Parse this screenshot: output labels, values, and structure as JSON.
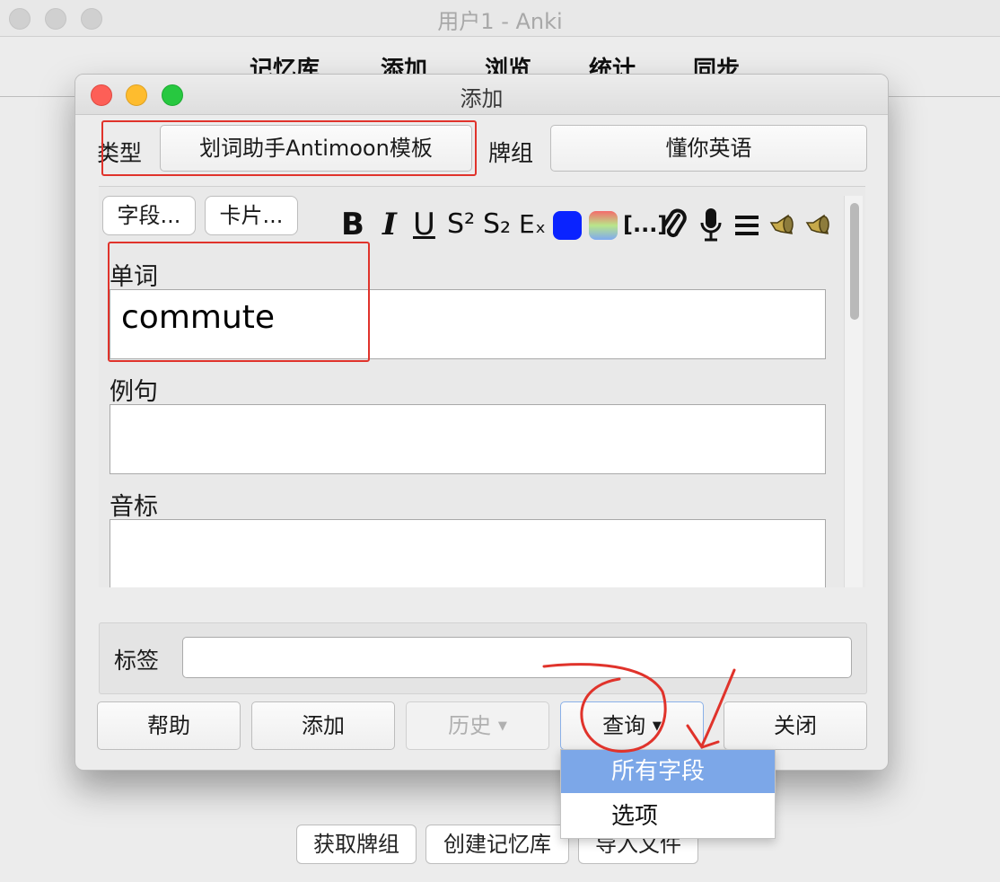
{
  "main_window": {
    "title": "用户1 - Anki",
    "toolbar": [
      "记忆库",
      "添加",
      "浏览",
      "统计",
      "同步"
    ],
    "bottom_buttons": [
      "获取牌组",
      "创建记忆库",
      "导入文件"
    ]
  },
  "dialog": {
    "title": "添加",
    "type_label": "类型",
    "type_value": "划词助手Antimoon模板",
    "deck_label": "牌组",
    "deck_value": "懂你英语",
    "fields_button": "字段...",
    "cards_button": "卡片...",
    "format_toolbar": {
      "bold": "B",
      "italic": "I",
      "underline": "U",
      "superscript": "S²",
      "subscript": "S₂",
      "clear_format": "Eₓ",
      "cloze": "[...]",
      "attach": "attach-icon",
      "record": "mic-icon",
      "more": "menu-icon",
      "speaker1": "speaker-icon",
      "speaker2": "speaker-icon",
      "color_text": "#0a23ff"
    },
    "fields": [
      {
        "label": "单词",
        "value": "commute"
      },
      {
        "label": "例句",
        "value": ""
      },
      {
        "label": "音标",
        "value": ""
      }
    ],
    "tags_label": "标签",
    "tags_value": "",
    "buttons": {
      "help": "帮助",
      "add": "添加",
      "history": "历史",
      "lookup": "查询",
      "close": "关闭"
    },
    "lookup_menu": {
      "items": [
        "所有字段",
        "选项"
      ],
      "selected_index": 0
    }
  },
  "colors": {
    "highlight_red": "#e0332b",
    "menu_selected": "#7ca7e8"
  }
}
